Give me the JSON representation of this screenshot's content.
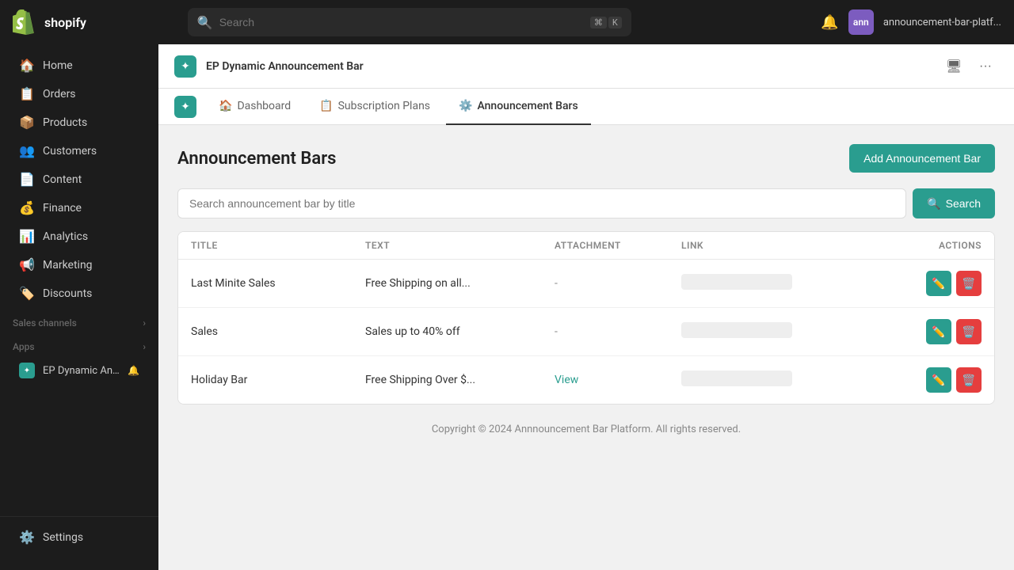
{
  "topbar": {
    "logo_text": "shopify",
    "search_placeholder": "Search",
    "shortcut_key1": "⌘",
    "shortcut_key2": "K",
    "store_name": "announcement-bar-platf...",
    "avatar_initials": "ann"
  },
  "sidebar": {
    "items": [
      {
        "id": "home",
        "label": "Home",
        "icon": "🏠"
      },
      {
        "id": "orders",
        "label": "Orders",
        "icon": "📋"
      },
      {
        "id": "products",
        "label": "Products",
        "icon": "📦"
      },
      {
        "id": "customers",
        "label": "Customers",
        "icon": "👥"
      },
      {
        "id": "content",
        "label": "Content",
        "icon": "📄"
      },
      {
        "id": "finance",
        "label": "Finance",
        "icon": "💰"
      },
      {
        "id": "analytics",
        "label": "Analytics",
        "icon": "📊"
      },
      {
        "id": "marketing",
        "label": "Marketing",
        "icon": "📢"
      },
      {
        "id": "discounts",
        "label": "Discounts",
        "icon": "🏷️"
      }
    ],
    "sales_channels_label": "Sales channels",
    "apps_label": "Apps",
    "app_item_label": "EP Dynamic Announ...",
    "settings_label": "Settings"
  },
  "app_header": {
    "title": "EP Dynamic Announcement Bar"
  },
  "nav_tabs": [
    {
      "id": "dashboard",
      "label": "Dashboard",
      "icon": "🏠"
    },
    {
      "id": "subscription",
      "label": "Subscription Plans",
      "icon": "📋"
    },
    {
      "id": "announcement_bars",
      "label": "Announcement Bars",
      "icon": "⚙️",
      "active": true
    }
  ],
  "page": {
    "title": "Announcement Bars",
    "add_button_label": "Add Announcement Bar",
    "search_placeholder": "Search announcement bar by title",
    "search_button_label": "Search"
  },
  "table": {
    "columns": [
      "TITLE",
      "TEXT",
      "ATTACHMENT",
      "LINK",
      "ACTIONS"
    ],
    "rows": [
      {
        "title": "Last Minite Sales",
        "text": "Free Shipping on all...",
        "attachment": "-",
        "link_blurred": true,
        "view_link": null
      },
      {
        "title": "Sales",
        "text": "Sales up to 40% off",
        "attachment": "-",
        "link_blurred": true,
        "view_link": null
      },
      {
        "title": "Holiday Bar",
        "text": "Free Shipping Over $...",
        "attachment": null,
        "link_blurred": true,
        "view_link": "View"
      }
    ]
  },
  "footer": {
    "copyright": "Copyright © 2024 Annnouncement Bar Platform. All rights reserved."
  }
}
